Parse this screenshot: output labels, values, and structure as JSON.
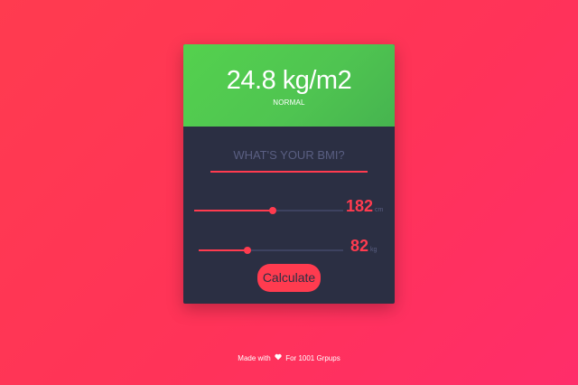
{
  "result": {
    "value": "24.8 kg/m2",
    "label": "NORMAL",
    "color": "#54d14e"
  },
  "form": {
    "question": "WHAT'S YOUR BMI?",
    "accent_color": "#ff3b4f",
    "height": {
      "value": "182",
      "unit": "cm",
      "fraction": 0.53
    },
    "weight": {
      "value": "82",
      "unit": "kg",
      "fraction": 0.34
    },
    "calculate_label": "Calculate"
  },
  "footer": {
    "before": "Made with",
    "icon": "heart-icon",
    "after": "For 1001 Grpups"
  }
}
